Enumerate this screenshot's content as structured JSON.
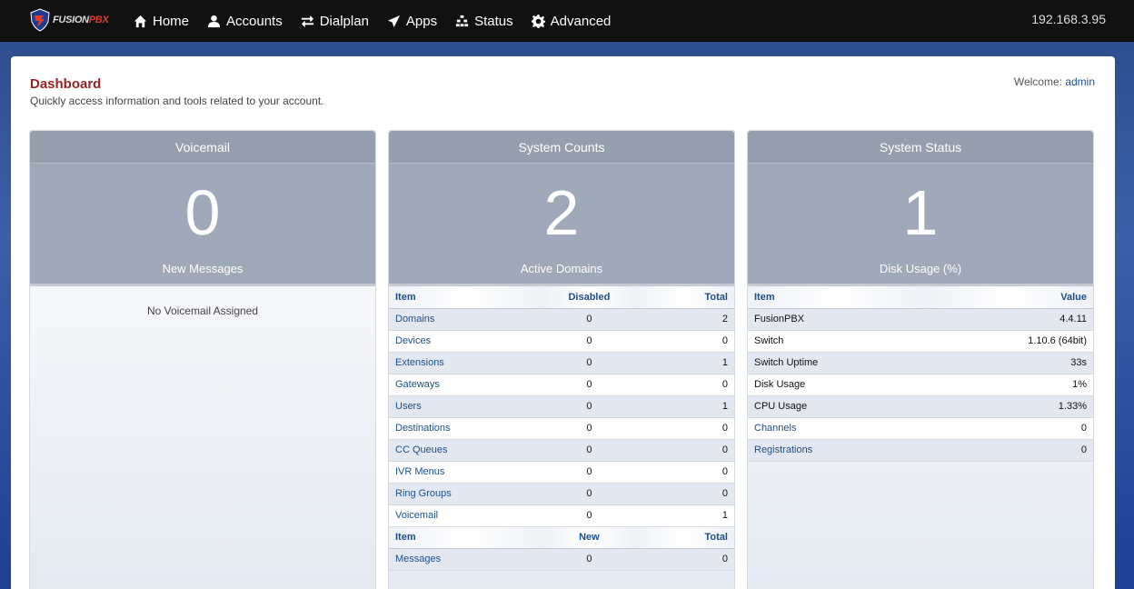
{
  "nav": {
    "brand": {
      "fusion": "FUSION",
      "pbx": "PBX"
    },
    "items": [
      {
        "label": "Home",
        "icon": "home-icon"
      },
      {
        "label": "Accounts",
        "icon": "user-icon"
      },
      {
        "label": "Dialplan",
        "icon": "exchange-icon"
      },
      {
        "label": "Apps",
        "icon": "send-icon"
      },
      {
        "label": "Status",
        "icon": "status-icon"
      },
      {
        "label": "Advanced",
        "icon": "gear-icon"
      }
    ],
    "ip": "192.168.3.95"
  },
  "page": {
    "title": "Dashboard",
    "subtitle": "Quickly access information and tools related to your account.",
    "welcome_label": "Welcome:",
    "welcome_user": "admin"
  },
  "voicemail": {
    "title": "Voicemail",
    "count": "0",
    "label": "New Messages",
    "empty": "No Voicemail Assigned"
  },
  "system_counts": {
    "title": "System Counts",
    "count": "2",
    "label": "Active Domains",
    "headers": [
      "Item",
      "Disabled",
      "Total"
    ],
    "rows": [
      [
        "Domains",
        "0",
        "2"
      ],
      [
        "Devices",
        "0",
        "0"
      ],
      [
        "Extensions",
        "0",
        "1"
      ],
      [
        "Gateways",
        "0",
        "0"
      ],
      [
        "Users",
        "0",
        "1"
      ],
      [
        "Destinations",
        "0",
        "0"
      ],
      [
        "CC Queues",
        "0",
        "0"
      ],
      [
        "IVR Menus",
        "0",
        "0"
      ],
      [
        "Ring Groups",
        "0",
        "0"
      ],
      [
        "Voicemail",
        "0",
        "1"
      ]
    ],
    "headers2": [
      "Item",
      "New",
      "Total"
    ],
    "rows2": [
      [
        "Messages",
        "0",
        "0"
      ]
    ]
  },
  "system_status": {
    "title": "System Status",
    "count": "1",
    "label": "Disk Usage (%)",
    "headers": [
      "Item",
      "Value"
    ],
    "rows": [
      [
        "FusionPBX",
        "4.4.11",
        false
      ],
      [
        "Switch",
        "1.10.6 (64bit)",
        false
      ],
      [
        "Switch Uptime",
        "33s",
        false
      ],
      [
        "Disk Usage",
        "1%",
        false
      ],
      [
        "CPU Usage",
        "1.33%",
        false
      ],
      [
        "Channels",
        "0",
        true
      ],
      [
        "Registrations",
        "0",
        true
      ]
    ]
  }
}
